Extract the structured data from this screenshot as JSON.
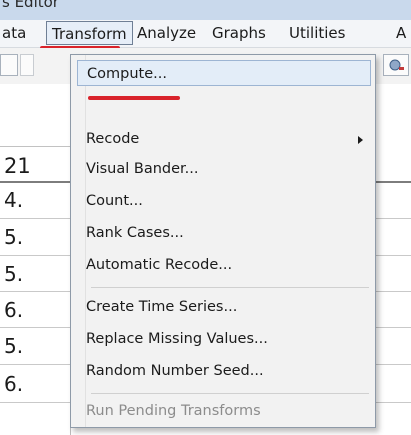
{
  "window": {
    "title": "s Editor"
  },
  "menubar": {
    "items": [
      {
        "label": "ata"
      },
      {
        "label": "Transform"
      },
      {
        "label": "Analyze"
      },
      {
        "label": "Graphs"
      },
      {
        "label": "Utilities"
      },
      {
        "label": "A"
      }
    ]
  },
  "grid": {
    "header_label": "21",
    "cells": [
      "4.",
      "5.",
      "5.",
      "6.",
      "5.",
      "6."
    ]
  },
  "transform_menu": {
    "items": [
      {
        "label": "Compute...",
        "state": "highlighted"
      },
      {
        "label": "Recode",
        "has_submenu": true
      },
      {
        "label": "Visual Bander..."
      },
      {
        "label": "Count..."
      },
      {
        "label": "Rank Cases..."
      },
      {
        "label": "Automatic Recode..."
      },
      {
        "label": "Create Time Series..."
      },
      {
        "label": "Replace Missing Values..."
      },
      {
        "label": "Random Number Seed..."
      },
      {
        "label": "Run Pending Transforms",
        "state": "disabled"
      }
    ]
  },
  "colors": {
    "annotation_red": "#d9232b",
    "menu_highlight": "#e3edf8",
    "titlebar": "#c9d9ec"
  }
}
